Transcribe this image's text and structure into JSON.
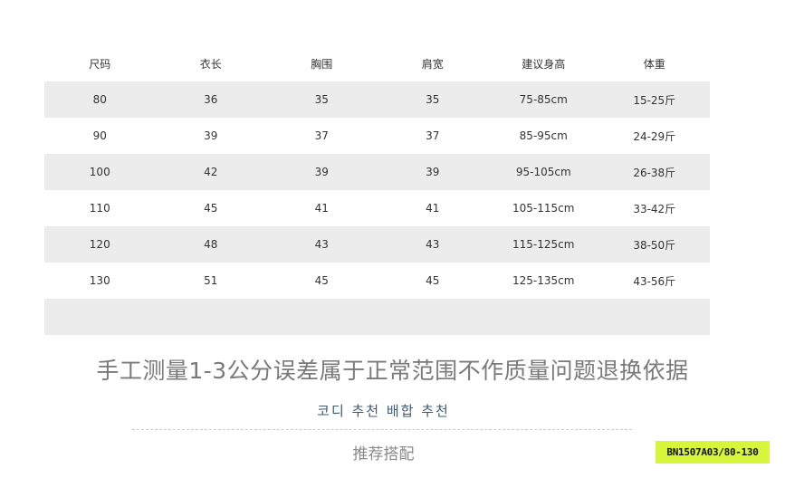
{
  "table": {
    "headers": [
      "尺码",
      "衣长",
      "胸围",
      "肩宽",
      "建议身高",
      "体重"
    ],
    "rows": [
      [
        "80",
        "36",
        "35",
        "35",
        "75-85cm",
        "15-25斤"
      ],
      [
        "90",
        "39",
        "37",
        "37",
        "85-95cm",
        "24-29斤"
      ],
      [
        "100",
        "42",
        "39",
        "39",
        "95-105cm",
        "26-38斤"
      ],
      [
        "110",
        "45",
        "41",
        "41",
        "105-115cm",
        "33-42斤"
      ],
      [
        "120",
        "48",
        "43",
        "43",
        "115-125cm",
        "38-50斤"
      ],
      [
        "130",
        "51",
        "45",
        "45",
        "125-135cm",
        "43-56斤"
      ]
    ]
  },
  "disclaimer": "手工测量1-3公分误差属于正常范围不作质量问题退换依据",
  "korean_heading": "코디 추천 배합 추천",
  "recommend_label": "推荐搭配",
  "product_code": "BN1507A03/80-130",
  "colors": {
    "row_stripe": "#ececec",
    "badge_bg": "#d6f53b",
    "korean_text": "#3f5b72"
  }
}
